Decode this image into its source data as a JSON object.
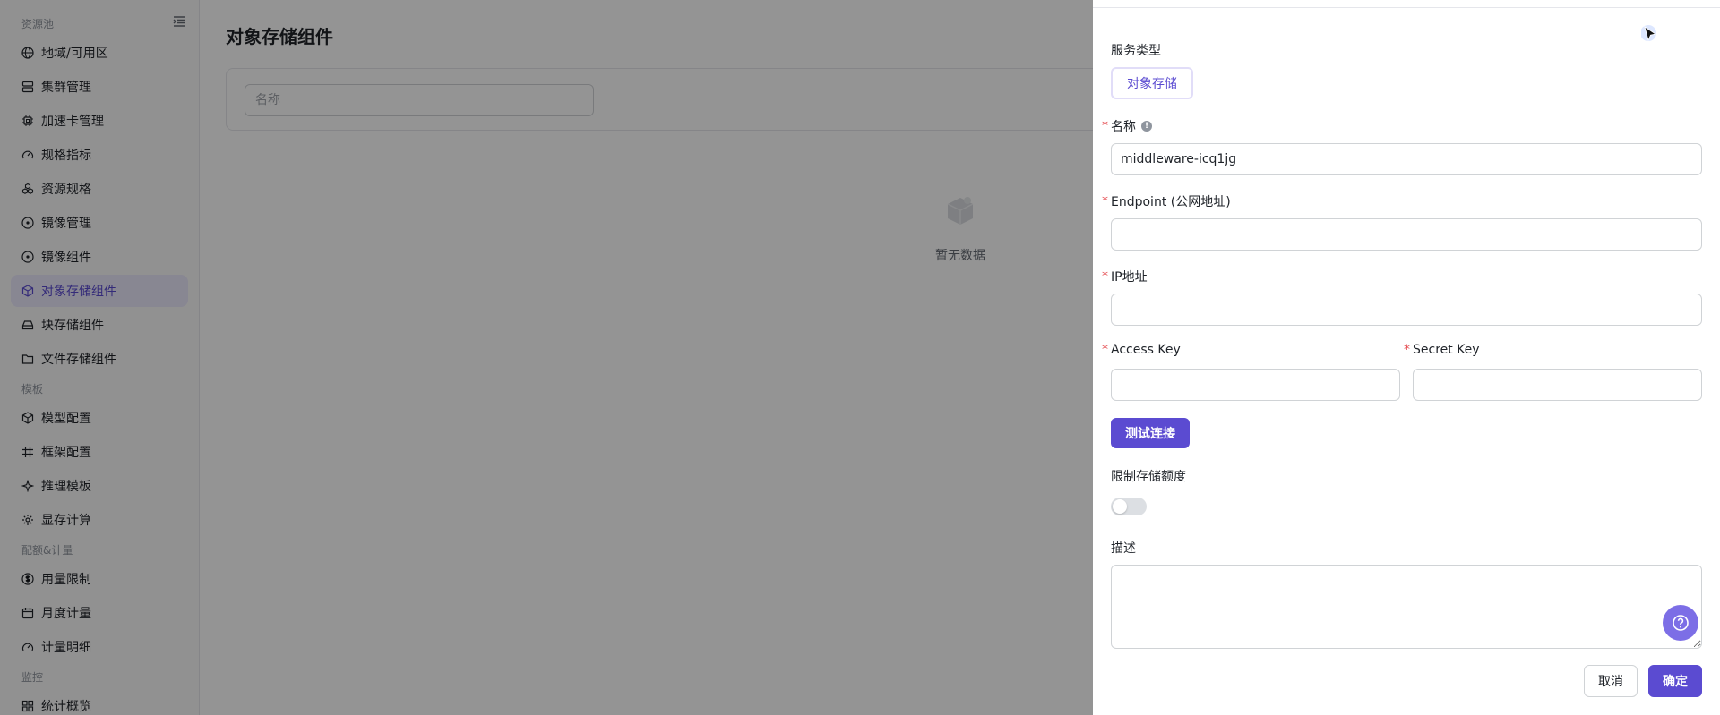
{
  "sidebar": {
    "groups": {
      "resource_pool": "资源池",
      "template": "模板",
      "quota_metering": "配额&计量",
      "monitoring": "监控"
    },
    "items": [
      {
        "label": "地域/可用区",
        "icon": "globe-icon"
      },
      {
        "label": "集群管理",
        "icon": "server-icon"
      },
      {
        "label": "加速卡管理",
        "icon": "chip-icon"
      },
      {
        "label": "规格指标",
        "icon": "gauge-icon"
      },
      {
        "label": "资源规格",
        "icon": "cubes-icon"
      },
      {
        "label": "镜像管理",
        "icon": "disc-icon"
      },
      {
        "label": "镜像组件",
        "icon": "disc-icon"
      },
      {
        "label": "对象存储组件",
        "icon": "box-icon",
        "active": true
      },
      {
        "label": "块存储组件",
        "icon": "drive-icon"
      },
      {
        "label": "文件存储组件",
        "icon": "folder-icon"
      },
      {
        "label": "模型配置",
        "icon": "cube-icon"
      },
      {
        "label": "框架配置",
        "icon": "hash-icon"
      },
      {
        "label": "推理模板",
        "icon": "sparkle-icon"
      },
      {
        "label": "显存计算",
        "icon": "gear-icon"
      },
      {
        "label": "用量限制",
        "icon": "dollar-icon"
      },
      {
        "label": "月度计量",
        "icon": "calendar-icon"
      },
      {
        "label": "计量明细",
        "icon": "gauge-icon"
      },
      {
        "label": "统计概览",
        "icon": "grid-icon"
      }
    ]
  },
  "main": {
    "title": "对象存储组件",
    "filter_placeholder": "名称",
    "empty_text": "暂无数据"
  },
  "drawer": {
    "service_type_label": "服务类型",
    "service_type_value": "对象存储",
    "name_label": "名称",
    "name_value": "middleware-icq1jg",
    "endpoint_label": "Endpoint (公网地址)",
    "endpoint_value": "",
    "ip_label": "IP地址",
    "ip_value": "",
    "access_key_label": "Access Key",
    "access_key_value": "",
    "secret_key_label": "Secret Key",
    "secret_key_value": "",
    "test_button": "测试连接",
    "quota_label": "限制存储额度",
    "quota_enabled": false,
    "description_label": "描述",
    "description_value": "",
    "cancel_button": "取消",
    "confirm_button": "确定"
  },
  "colors": {
    "accent": "#5b4bd1",
    "active_bg": "#ebe8fb",
    "required": "#e5484d"
  }
}
